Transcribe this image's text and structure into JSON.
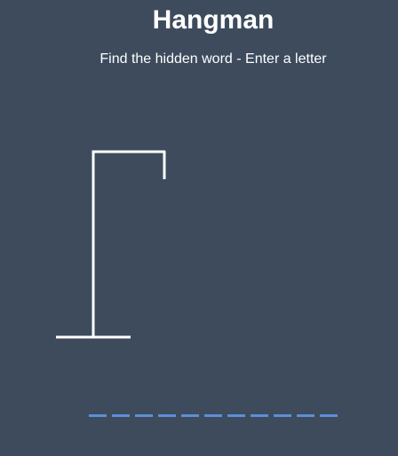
{
  "header": {
    "title": "Hangman",
    "subtitle": "Find the hidden word - Enter a letter"
  },
  "game": {
    "word_letters": [
      "",
      "",
      "",
      "",
      "",
      "",
      "",
      "",
      "",
      "",
      ""
    ],
    "colors": {
      "background": "#3d4b5d",
      "gallows": "#ffffff",
      "letter_slot": "#5b8fd9"
    }
  }
}
